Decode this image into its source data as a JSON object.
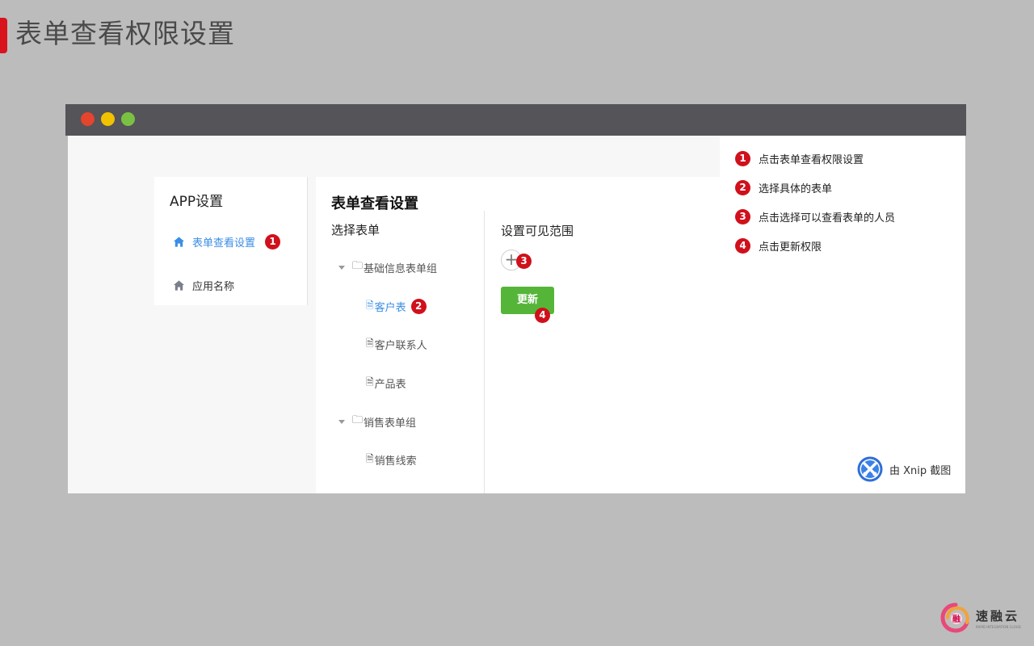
{
  "slide": {
    "title": "表单查看权限设置"
  },
  "window": {
    "sidebar": {
      "title": "APP设置",
      "items": [
        {
          "label": "表单查看设置",
          "active": true
        },
        {
          "label": "应用名称",
          "active": false
        }
      ]
    },
    "main": {
      "title": "表单查看设置",
      "select_form_label": "选择表单",
      "visibility_label": "设置可见范围",
      "add_symbol": "+",
      "update_button": "更新",
      "tree": [
        {
          "label": "基础信息表单组",
          "type": "group"
        },
        {
          "label": "客户表",
          "type": "form",
          "selected": true
        },
        {
          "label": "客户联系人",
          "type": "form"
        },
        {
          "label": "产品表",
          "type": "form"
        },
        {
          "label": "销售表单组",
          "type": "group"
        },
        {
          "label": "销售线索",
          "type": "form"
        }
      ]
    },
    "badges": [
      "1",
      "2",
      "3",
      "4"
    ],
    "instructions": [
      {
        "num": "1",
        "text": "点击表单查看权限设置"
      },
      {
        "num": "2",
        "text": "选择具体的表单"
      },
      {
        "num": "3",
        "text": "点击选择可以查看表单的人员"
      },
      {
        "num": "4",
        "text": "点击更新权限"
      }
    ],
    "watermark": "由 Xnip 截图"
  },
  "brand": {
    "name": "速融云",
    "tagline": "RAPID INTEGRATION CLOUD"
  },
  "colors": {
    "accent_blue": "#3a8ee6",
    "badge_red": "#d0101b",
    "update_green": "#55b539",
    "titlebar_gray": "#545459",
    "title_bar_red": "#d9131e"
  }
}
